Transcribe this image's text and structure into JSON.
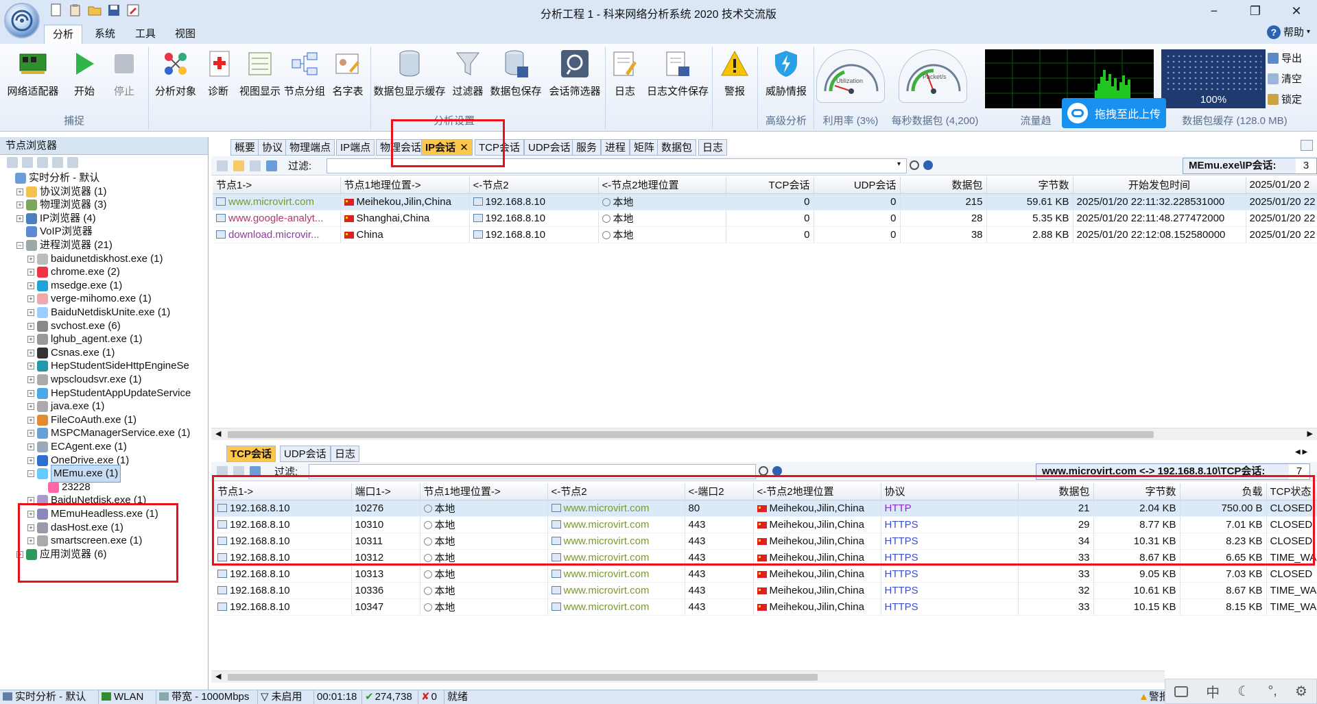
{
  "window": {
    "title": "分析工程 1 - 科来网络分析系统 2020 技术交流版",
    "minimize": "−",
    "restore": "❐",
    "close": "✕"
  },
  "menu": {
    "tabs": [
      "分析",
      "系统",
      "工具",
      "视图"
    ],
    "help": "帮助"
  },
  "ribbon": {
    "buttons": [
      "网络适配器",
      "开始",
      "停止",
      "分析对象",
      "诊断",
      "视图显示",
      "节点分组",
      "名字表",
      "数据包显示缓存",
      "过滤器",
      "数据包保存",
      "会话筛选器",
      "日志",
      "日志文件保存",
      "警报",
      "威胁情报"
    ],
    "groups": [
      "捕捉",
      "分析设置",
      "高级分析",
      "利用率 (3%)",
      "每秒数据包 (4,200)",
      "流量趋",
      "数据包缓存 (128.0 MB)"
    ],
    "gauge_labels": [
      "Utilization",
      "Packet/s"
    ],
    "buffer_percent": "100%",
    "side_buttons": [
      "导出",
      "清空",
      "锁定"
    ],
    "upload_popup": "拖拽至此上传"
  },
  "sidebar": {
    "title": "节点浏览器",
    "tree": [
      {
        "label": "实时分析 - 默认",
        "level": 0,
        "exp": ""
      },
      {
        "label": "协议浏览器 (1)",
        "level": 1,
        "exp": "+"
      },
      {
        "label": "物理浏览器 (3)",
        "level": 1,
        "exp": "+"
      },
      {
        "label": "IP浏览器 (4)",
        "level": 1,
        "exp": "+"
      },
      {
        "label": "VoIP浏览器",
        "level": 1,
        "exp": ""
      },
      {
        "label": "进程浏览器 (21)",
        "level": 1,
        "exp": "−"
      },
      {
        "label": "baidunetdiskhost.exe (1)",
        "level": 2,
        "exp": "+"
      },
      {
        "label": "chrome.exe (2)",
        "level": 2,
        "exp": "+"
      },
      {
        "label": "msedge.exe (1)",
        "level": 2,
        "exp": "+"
      },
      {
        "label": "verge-mihomo.exe (1)",
        "level": 2,
        "exp": "+"
      },
      {
        "label": "BaiduNetdiskUnite.exe (1)",
        "level": 2,
        "exp": "+"
      },
      {
        "label": "svchost.exe (6)",
        "level": 2,
        "exp": "+"
      },
      {
        "label": "lghub_agent.exe (1)",
        "level": 2,
        "exp": "+"
      },
      {
        "label": "Csnas.exe (1)",
        "level": 2,
        "exp": "+"
      },
      {
        "label": "HepStudentSideHttpEngineSe",
        "level": 2,
        "exp": "+"
      },
      {
        "label": "wpscloudsvr.exe (1)",
        "level": 2,
        "exp": "+"
      },
      {
        "label": "HepStudentAppUpdateService",
        "level": 2,
        "exp": "+"
      },
      {
        "label": "java.exe (1)",
        "level": 2,
        "exp": "+"
      },
      {
        "label": "FileCoAuth.exe (1)",
        "level": 2,
        "exp": "+"
      },
      {
        "label": "MSPCManagerService.exe (1)",
        "level": 2,
        "exp": "+"
      },
      {
        "label": "ECAgent.exe (1)",
        "level": 2,
        "exp": "+"
      },
      {
        "label": "OneDrive.exe (1)",
        "level": 2,
        "exp": "+"
      },
      {
        "label": "MEmu.exe (1)",
        "level": 2,
        "exp": "−"
      },
      {
        "label": "23228",
        "level": 3,
        "exp": ""
      },
      {
        "label": "BaiduNetdisk.exe (1)",
        "level": 2,
        "exp": "+"
      },
      {
        "label": "MEmuHeadless.exe (1)",
        "level": 2,
        "exp": "+"
      },
      {
        "label": "dasHost.exe (1)",
        "level": 2,
        "exp": "+"
      },
      {
        "label": "smartscreen.exe (1)",
        "level": 2,
        "exp": "+"
      },
      {
        "label": "应用浏览器 (6)",
        "level": 1,
        "exp": "+"
      }
    ]
  },
  "top_tabs": [
    "概要",
    "协议",
    "物理端点",
    "IP端点",
    "物理会话",
    "IP会话",
    "TCP会话",
    "UDP会话",
    "服务",
    "进程",
    "矩阵",
    "数据包",
    "日志"
  ],
  "top_panel": {
    "filter_label": "过滤:",
    "context": "MEmu.exe\\IP会话:",
    "context_count": "3",
    "columns": [
      "节点1->",
      "节点1地理位置->",
      "<-节点2",
      "<-节点2地理位置",
      "TCP会话",
      "UDP会话",
      "数据包",
      "字节数",
      "开始发包时间",
      "2025/01/20 2"
    ],
    "rows": [
      {
        "node1": "www.microvirt.com",
        "geo1": "Meihekou,Jilin,China",
        "node2": "192.168.8.10",
        "geo2": "本地",
        "tcp": "0",
        "udp": "0",
        "packets": "215",
        "bytes": "59.61 KB",
        "start": "2025/01/20 22:11:32.228531000",
        "end": "2025/01/20 22"
      },
      {
        "node1": "www.google-analyt...",
        "geo1": "Shanghai,China",
        "node2": "192.168.8.10",
        "geo2": "本地",
        "tcp": "0",
        "udp": "0",
        "packets": "28",
        "bytes": "5.35 KB",
        "start": "2025/01/20 22:11:48.277472000",
        "end": "2025/01/20 22"
      },
      {
        "node1": "download.microvir...",
        "geo1": "China",
        "node2": "192.168.8.10",
        "geo2": "本地",
        "tcp": "0",
        "udp": "0",
        "packets": "38",
        "bytes": "2.88 KB",
        "start": "2025/01/20 22:12:08.152580000",
        "end": "2025/01/20 22"
      }
    ]
  },
  "bottom_tabs": [
    "TCP会话",
    "UDP会话",
    "日志"
  ],
  "bottom_panel": {
    "filter_label": "过滤:",
    "context": "www.microvirt.com <-> 192.168.8.10\\TCP会话:",
    "context_count": "7",
    "columns": [
      "节点1->",
      "端口1->",
      "节点1地理位置->",
      "<-节点2",
      "<-端口2",
      "<-节点2地理位置",
      "协议",
      "数据包",
      "字节数",
      "负载",
      "TCP状态"
    ],
    "rows": [
      {
        "node1": "192.168.8.10",
        "port1": "10276",
        "geo1": "本地",
        "node2": "www.microvirt.com",
        "port2": "80",
        "geo2": "Meihekou,Jilin,China",
        "proto": "HTTP",
        "packets": "21",
        "bytes": "2.04 KB",
        "payload": "750.00 B",
        "state": "CLOSED"
      },
      {
        "node1": "192.168.8.10",
        "port1": "10310",
        "geo1": "本地",
        "node2": "www.microvirt.com",
        "port2": "443",
        "geo2": "Meihekou,Jilin,China",
        "proto": "HTTPS",
        "packets": "29",
        "bytes": "8.77 KB",
        "payload": "7.01 KB",
        "state": "CLOSED"
      },
      {
        "node1": "192.168.8.10",
        "port1": "10311",
        "geo1": "本地",
        "node2": "www.microvirt.com",
        "port2": "443",
        "geo2": "Meihekou,Jilin,China",
        "proto": "HTTPS",
        "packets": "34",
        "bytes": "10.31 KB",
        "payload": "8.23 KB",
        "state": "CLOSED"
      },
      {
        "node1": "192.168.8.10",
        "port1": "10312",
        "geo1": "本地",
        "node2": "www.microvirt.com",
        "port2": "443",
        "geo2": "Meihekou,Jilin,China",
        "proto": "HTTPS",
        "packets": "33",
        "bytes": "8.67 KB",
        "payload": "6.65 KB",
        "state": "TIME_WAIT"
      },
      {
        "node1": "192.168.8.10",
        "port1": "10313",
        "geo1": "本地",
        "node2": "www.microvirt.com",
        "port2": "443",
        "geo2": "Meihekou,Jilin,China",
        "proto": "HTTPS",
        "packets": "33",
        "bytes": "9.05 KB",
        "payload": "7.03 KB",
        "state": "CLOSED"
      },
      {
        "node1": "192.168.8.10",
        "port1": "10336",
        "geo1": "本地",
        "node2": "www.microvirt.com",
        "port2": "443",
        "geo2": "Meihekou,Jilin,China",
        "proto": "HTTPS",
        "packets": "32",
        "bytes": "10.61 KB",
        "payload": "8.67 KB",
        "state": "TIME_WAIT"
      },
      {
        "node1": "192.168.8.10",
        "port1": "10347",
        "geo1": "本地",
        "node2": "www.microvirt.com",
        "port2": "443",
        "geo2": "Meihekou,Jilin,China",
        "proto": "HTTPS",
        "packets": "33",
        "bytes": "10.15 KB",
        "payload": "8.15 KB",
        "state": "TIME_WAIT"
      }
    ]
  },
  "statusbar": {
    "mode": "实时分析 - 默认",
    "adapter": "WLAN",
    "bandwidth": "带宽 - 1000Mbps",
    "filter": "未启用",
    "time": "00:01:18",
    "packets": "274,738",
    "drops": "0",
    "status": "就绪",
    "alarm": "警报"
  },
  "ime": [
    "中"
  ],
  "colors": {
    "highlight_box": "#e8101a",
    "active_tab": "#ffc64c"
  }
}
